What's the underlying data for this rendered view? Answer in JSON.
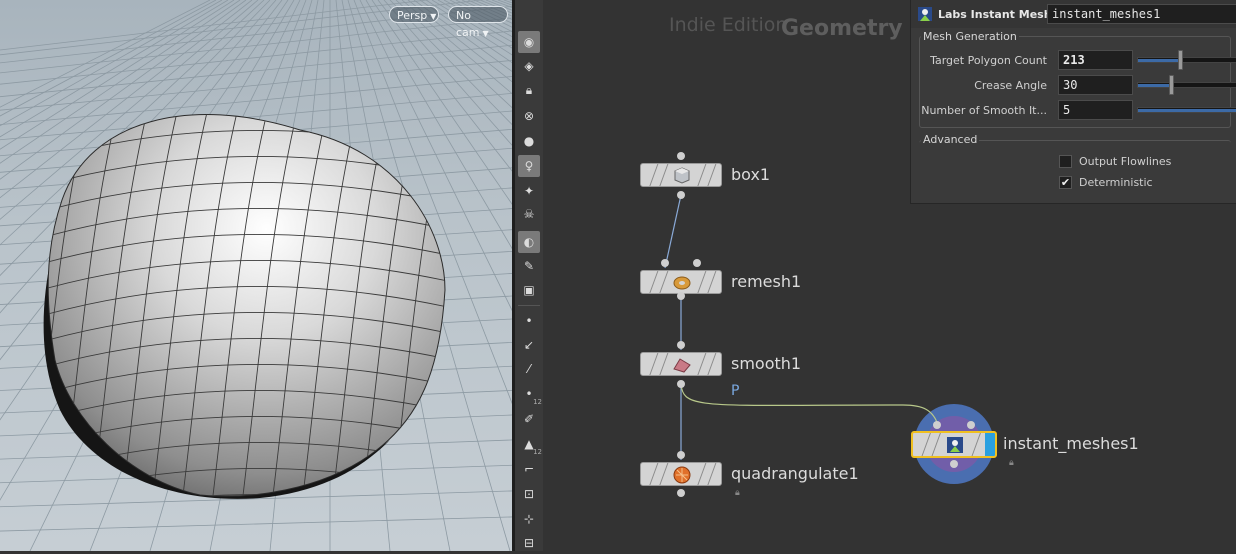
{
  "viewport": {
    "view_menu": "Persp",
    "camera_menu": "No cam"
  },
  "toolbar": {
    "icons": [
      "visibility-eye-icon",
      "display-geometry-icon",
      "lock-icon",
      "ghost-icon",
      "shading-sphere-icon",
      "light-bulb-icon",
      "headlight-icon",
      "skeleton-icon",
      "texture-icon",
      "snapshot-icon",
      "camera-icon",
      "point-icon",
      "normal-icon",
      "vector-icon",
      "point-number-icon",
      "brush-icon",
      "primitive-number-icon",
      "guide-icon",
      "transform-icon",
      "snap-icon",
      "grid-icon"
    ],
    "badges": {
      "point_number": "12",
      "primitive_number": "12"
    }
  },
  "network": {
    "edition_label": "Indie Edition",
    "context_label": "Geometry",
    "wire_label": "P",
    "nodes": [
      {
        "name": "box1"
      },
      {
        "name": "remesh1"
      },
      {
        "name": "smooth1"
      },
      {
        "name": "quadrangulate1"
      },
      {
        "name": "instant_meshes1"
      }
    ]
  },
  "parameters": {
    "node_type": "Labs Instant Meshes",
    "node_name": "instant_meshes1",
    "folders": {
      "mesh_generation": "Mesh Generation",
      "advanced": "Advanced"
    },
    "params": [
      {
        "label": "Target Polygon Count",
        "value": "213",
        "slider_fraction": 0.42
      },
      {
        "label": "Crease Angle",
        "value": "30",
        "slider_fraction": 0.33
      },
      {
        "label": "Number of Smooth It...",
        "value": "5",
        "slider_fraction": 0.5
      }
    ],
    "toggles": [
      {
        "label": "Output Flowlines",
        "checked": false,
        "mark": ""
      },
      {
        "label": "Deterministic",
        "checked": true,
        "mark": "✔"
      }
    ]
  },
  "colors": {
    "accent": "#3c6aa6",
    "selected_node": "#f0c020",
    "wire": "#8aaad8",
    "highlight_wire": "#b8c88a"
  }
}
